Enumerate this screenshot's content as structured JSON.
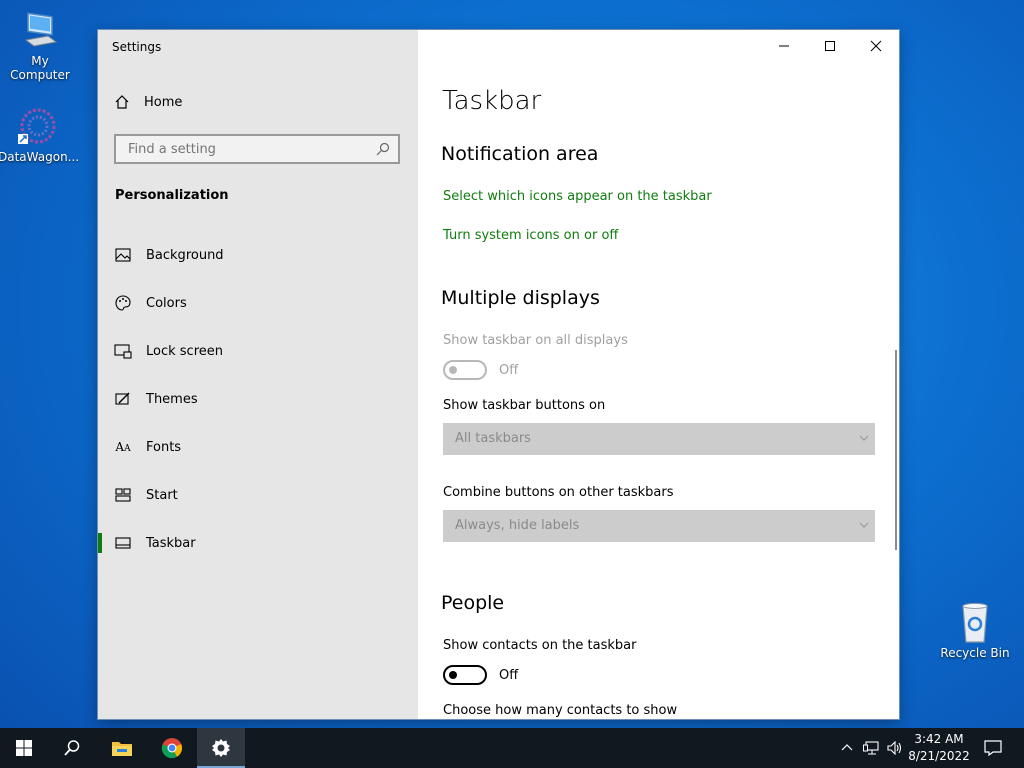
{
  "desktop": {
    "icons": [
      {
        "label": "My Computer",
        "icon": "computer-icon"
      },
      {
        "label": "DataWagon...",
        "icon": "datawagon-icon"
      },
      {
        "label": "Recycle Bin",
        "icon": "recycle-bin-icon"
      }
    ]
  },
  "window": {
    "title": "Settings",
    "controls": [
      "minimize-icon",
      "maximize-icon",
      "close-icon"
    ]
  },
  "sidebar": {
    "home_label": "Home",
    "search_placeholder": "Find a setting",
    "section": "Personalization",
    "items": [
      {
        "label": "Background",
        "icon": "picture-icon"
      },
      {
        "label": "Colors",
        "icon": "palette-icon"
      },
      {
        "label": "Lock screen",
        "icon": "lock-screen-icon"
      },
      {
        "label": "Themes",
        "icon": "themes-icon"
      },
      {
        "label": "Fonts",
        "icon": "fonts-icon"
      },
      {
        "label": "Start",
        "icon": "start-icon"
      },
      {
        "label": "Taskbar",
        "icon": "taskbar-icon",
        "active": true
      }
    ]
  },
  "content": {
    "title": "Taskbar",
    "notification_area": {
      "heading": "Notification area",
      "link1": "Select which icons appear on the taskbar",
      "link2": "Turn system icons on or off"
    },
    "multiple_displays": {
      "heading": "Multiple displays",
      "show_all_label": "Show taskbar on all displays",
      "show_all_state": "Off",
      "buttons_on_label": "Show taskbar buttons on",
      "buttons_on_value": "All taskbars",
      "combine_label": "Combine buttons on other taskbars",
      "combine_value": "Always, hide labels"
    },
    "people": {
      "heading": "People",
      "contacts_label": "Show contacts on the taskbar",
      "contacts_state": "Off",
      "how_many_label": "Choose how many contacts to show"
    }
  },
  "taskbar": {
    "items": [
      "start-icon",
      "search-icon",
      "file-explorer-icon",
      "chrome-icon",
      "settings-icon"
    ],
    "tray": [
      "chevron-up-icon",
      "network-icon",
      "volume-icon",
      "notification-icon"
    ],
    "time": "3:42 AM",
    "date": "8/21/2022"
  },
  "colors": {
    "accent": "#107c10",
    "sidebar_bg": "#e6e6e6",
    "taskbar_bg": "#101820"
  }
}
